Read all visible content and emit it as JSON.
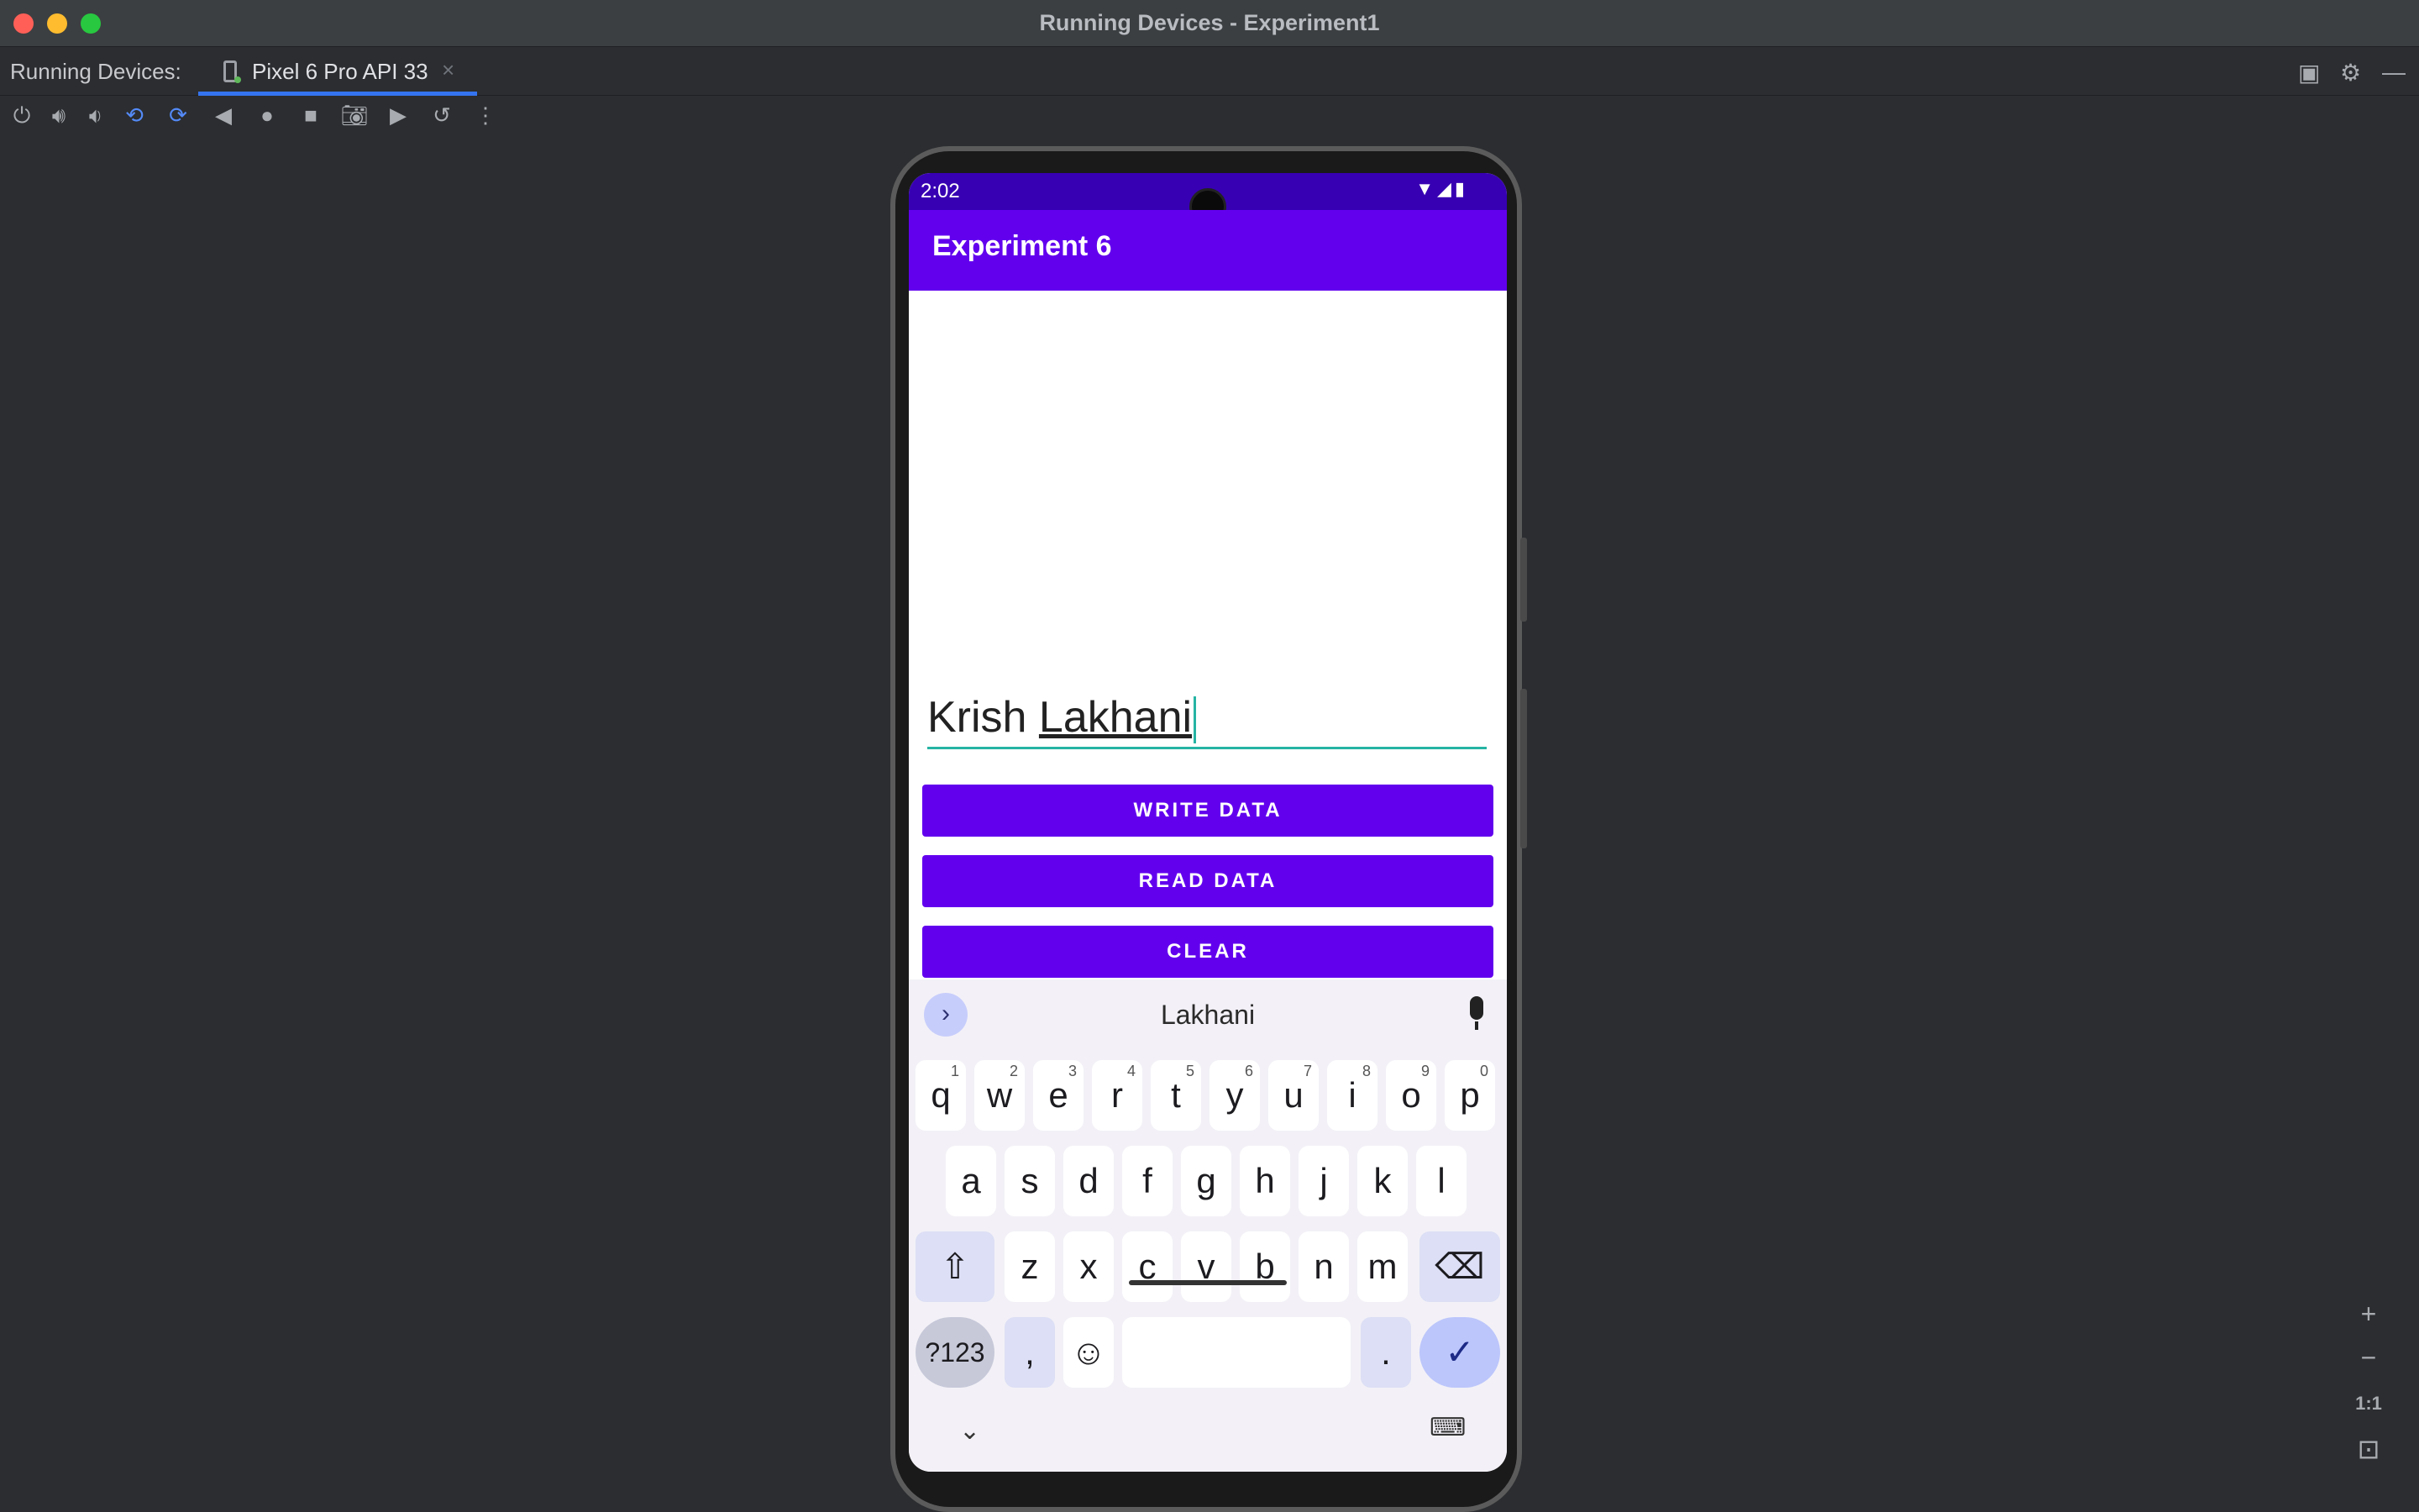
{
  "window": {
    "title": "Running Devices - Experiment1"
  },
  "tabbar": {
    "label": "Running Devices:",
    "tab": "Pixel 6 Pro API 33",
    "tab_close": "×"
  },
  "toolbar": {
    "icons": [
      "power-icon",
      "volume-up-icon",
      "volume-down-icon",
      "rotate-left-icon",
      "rotate-right-icon",
      "back-icon",
      "home-icon",
      "overview-icon",
      "screenshot-icon",
      "record-icon",
      "reset-icon",
      "more-icon"
    ]
  },
  "phone": {
    "status": {
      "time": "2:02",
      "icons": "▼◢▮"
    },
    "app_title": "Experiment 6",
    "edit_text": {
      "first": "Krish ",
      "second": "Lakhani"
    },
    "buttons": {
      "write": "WRITE DATA",
      "read": "READ DATA",
      "clear": "CLEAR"
    },
    "keyboard": {
      "suggestion": "Lakhani",
      "expand": "›",
      "row1": [
        "q",
        "w",
        "e",
        "r",
        "t",
        "y",
        "u",
        "i",
        "o",
        "p"
      ],
      "row1_num": [
        "1",
        "2",
        "3",
        "4",
        "5",
        "6",
        "7",
        "8",
        "9",
        "0"
      ],
      "row2": [
        "a",
        "s",
        "d",
        "f",
        "g",
        "h",
        "j",
        "k",
        "l"
      ],
      "row3": [
        "z",
        "x",
        "c",
        "v",
        "b",
        "n",
        "m"
      ],
      "shift": "⇧",
      "backspace": "⌫",
      "symbols": "?123",
      "comma": ",",
      "emoji": "☺",
      "period": ".",
      "enter": "✓",
      "hide": "⌄",
      "switch": "⌨"
    }
  },
  "zoom": {
    "plus": "+",
    "minus": "−",
    "one_to_one": "1:1",
    "fit": "⊡"
  }
}
